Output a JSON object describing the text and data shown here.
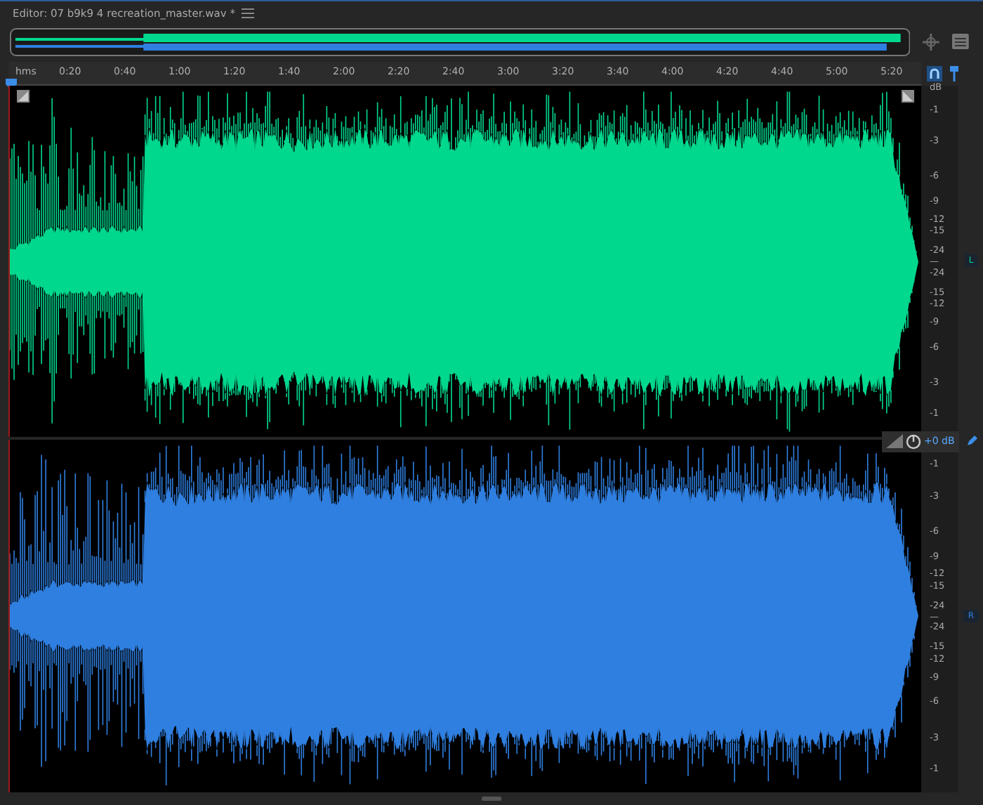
{
  "editor_tab": {
    "title": "Editor: 07 b9k9 4 recreation_master.wav *"
  },
  "ruler": {
    "unit": "hms",
    "labels": [
      "0:20",
      "0:40",
      "1:00",
      "1:20",
      "1:40",
      "2:00",
      "2:20",
      "2:40",
      "3:00",
      "3:20",
      "3:40",
      "4:00",
      "4:20",
      "4:40",
      "5:00",
      "5:20"
    ]
  },
  "channels": [
    {
      "name": "L",
      "color": "#00d88e",
      "unit_label": "dB",
      "db_labels": [
        "-1",
        "-3",
        "-6",
        "-9",
        "-12",
        "-15",
        "-24",
        "—",
        "-24",
        "-15",
        "-12",
        "-9",
        "-6",
        "-3",
        "-1"
      ]
    },
    {
      "name": "R",
      "color": "#2f7fe0",
      "db_labels": [
        "-1",
        "-3",
        "-6",
        "-9",
        "-12",
        "-15",
        "-24",
        "—",
        "-24",
        "-15",
        "-12",
        "-9",
        "-6",
        "-3",
        "-1"
      ]
    }
  ],
  "hud": {
    "gain": "+0 dB"
  }
}
